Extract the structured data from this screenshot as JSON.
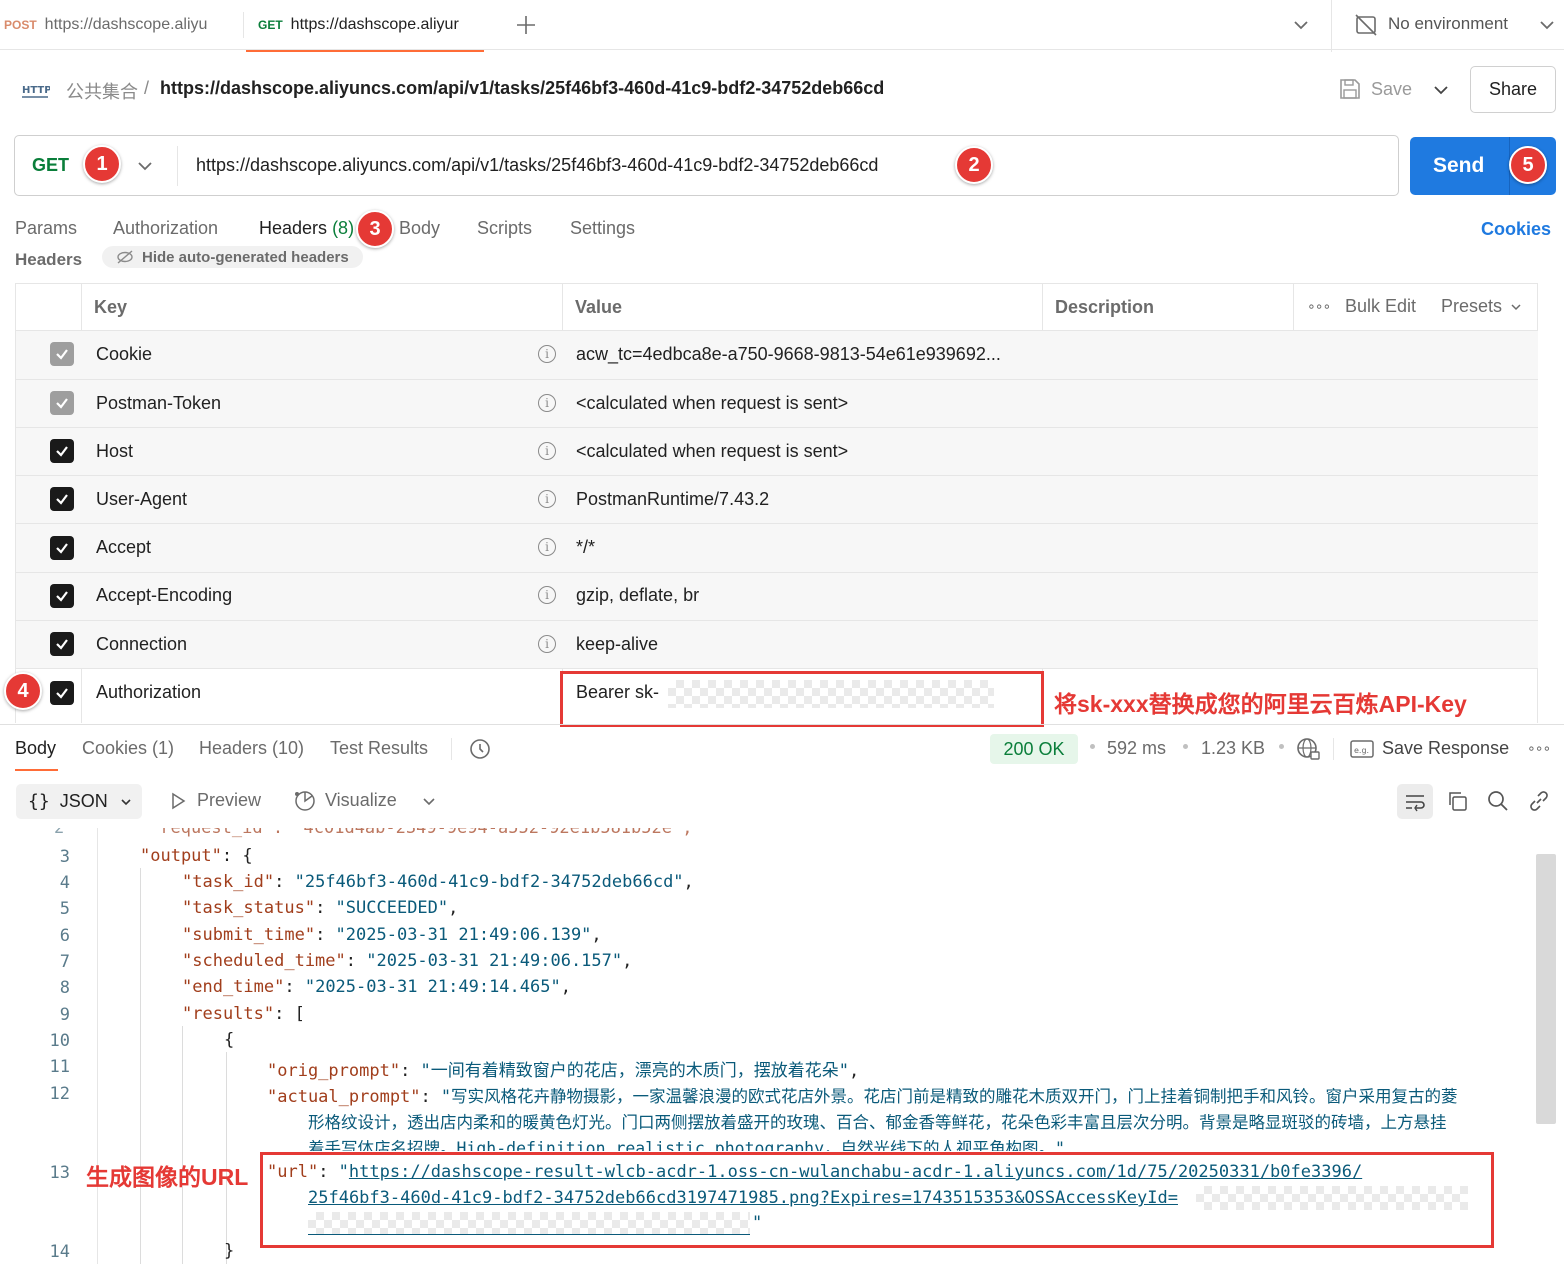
{
  "tabs": [
    {
      "method": "POST",
      "url": "https://dashscope.aliyu"
    },
    {
      "method": "GET",
      "url": "https://dashscope.aliyur"
    }
  ],
  "environment": "No environment",
  "breadcrumb": {
    "collection": "公共集合",
    "separator": "/",
    "title": "https://dashscope.aliyuncs.com/api/v1/tasks/25f46bf3-460d-41c9-bdf2-34752deb66cd"
  },
  "save_label": "Save",
  "share_label": "Share",
  "request": {
    "method": "GET",
    "url": "https://dashscope.aliyuncs.com/api/v1/tasks/25f46bf3-460d-41c9-bdf2-34752deb66cd",
    "send_label": "Send"
  },
  "badges": [
    "1",
    "2",
    "3",
    "4",
    "5"
  ],
  "request_tabs": {
    "params": "Params",
    "authorization": "Authorization",
    "headers": "Headers",
    "headers_count": "(8)",
    "body": "Body",
    "scripts": "Scripts",
    "settings": "Settings",
    "cookies": "Cookies"
  },
  "headers_section": {
    "title": "Headers",
    "hide_auto": "Hide auto-generated headers"
  },
  "headers_table": {
    "columns": {
      "key": "Key",
      "value": "Value",
      "description": "Description",
      "bulk_edit": "Bulk Edit",
      "presets": "Presets"
    },
    "rows": [
      {
        "key": "Cookie",
        "value": "acw_tc=4edbca8e-a750-9668-9813-54e61e939692...",
        "checked": "disabled"
      },
      {
        "key": "Postman-Token",
        "value": "<calculated when request is sent>",
        "checked": "disabled"
      },
      {
        "key": "Host",
        "value": "<calculated when request is sent>",
        "checked": "true"
      },
      {
        "key": "User-Agent",
        "value": "PostmanRuntime/7.43.2",
        "checked": "true"
      },
      {
        "key": "Accept",
        "value": "*/*",
        "checked": "true"
      },
      {
        "key": "Accept-Encoding",
        "value": "gzip, deflate, br",
        "checked": "true"
      },
      {
        "key": "Connection",
        "value": "keep-alive",
        "checked": "true"
      },
      {
        "key": "Authorization",
        "value": "Bearer sk-",
        "checked": "true"
      }
    ]
  },
  "annotation_apikey": "将sk-xxx替换成您的阿里云百炼API-Key",
  "annotation_url": "生成图像的URL",
  "response_tabs": {
    "body": "Body",
    "cookies": "Cookies (1)",
    "headers": "Headers (10)",
    "test_results": "Test Results"
  },
  "response_meta": {
    "status": "200 OK",
    "time": "592 ms",
    "size": "1.23 KB",
    "save_response": "Save Response"
  },
  "response_toolbar": {
    "format": "JSON",
    "preview": "Preview",
    "visualize": "Visualize"
  },
  "code": {
    "line_numbers": [
      "3",
      "4",
      "5",
      "6",
      "7",
      "8",
      "9",
      "10",
      "11",
      "12",
      "13",
      "14"
    ],
    "output_key": "\"output\"",
    "task_id": {
      "key": "\"task_id\"",
      "value": "\"25f46bf3-460d-41c9-bdf2-34752deb66cd\""
    },
    "task_status": {
      "key": "\"task_status\"",
      "value": "\"SUCCEEDED\""
    },
    "submit_time": {
      "key": "\"submit_time\"",
      "value": "\"2025-03-31 21:49:06.139\""
    },
    "scheduled_time": {
      "key": "\"scheduled_time\"",
      "value": "\"2025-03-31 21:49:06.157\""
    },
    "end_time": {
      "key": "\"end_time\"",
      "value": "\"2025-03-31 21:49:14.465\""
    },
    "results_key": "\"results\"",
    "orig_prompt": {
      "key": "\"orig_prompt\"",
      "value": "\"一间有着精致窗户的花店，漂亮的木质门，摆放着花朵\""
    },
    "actual_prompt": {
      "key": "\"actual_prompt\"",
      "line1": "\"写实风格花卉静物摄影，一家温馨浪漫的欧式花店外景。花店门前是精致的雕花木质双开门，门上挂着铜制把手和风铃。窗户采用复古的菱",
      "line2": "形格纹设计，透出店内柔和的暖黄色灯光。门口两侧摆放着盛开的玫瑰、百合、郁金香等鲜花，花朵色彩丰富且层次分明。背景是略显斑驳的砖墙，上方悬挂",
      "line3": "着手写体店名招牌。High-definition realistic photography，自然光线下的人视平角构图。\","
    },
    "url": {
      "key": "\"url\"",
      "line1": "https://dashscope-result-wlcb-acdr-1.oss-cn-wulanchabu-acdr-1.aliyuncs.com/1d/75/20250331/b0fe3396/",
      "line2": "25f46bf3-460d-41c9-bdf2-34752deb66cd3197471985.png?Expires=1743515353&OSSAccessKeyId="
    }
  }
}
